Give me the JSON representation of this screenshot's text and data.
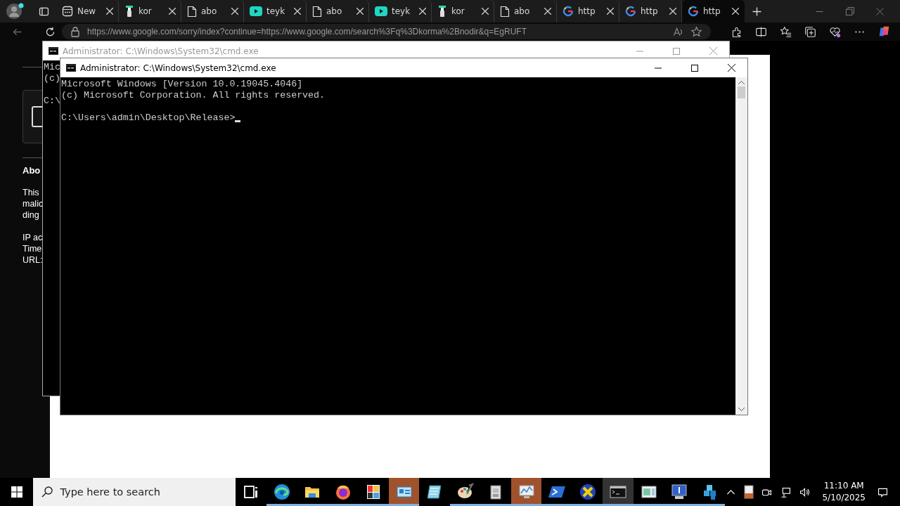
{
  "browser": {
    "tabs": [
      {
        "kind": "news",
        "label": "New",
        "selected": false
      },
      {
        "kind": "figure",
        "label": "kor",
        "selected": false
      },
      {
        "kind": "page",
        "label": "abo",
        "selected": false
      },
      {
        "kind": "play",
        "label": "teyk",
        "selected": false
      },
      {
        "kind": "page",
        "label": "abo",
        "selected": false
      },
      {
        "kind": "play",
        "label": "teyk",
        "selected": false
      },
      {
        "kind": "figure",
        "label": "kor",
        "selected": false
      },
      {
        "kind": "page",
        "label": "abo",
        "selected": false
      },
      {
        "kind": "google",
        "label": "http",
        "selected": false
      },
      {
        "kind": "google",
        "label": "http",
        "selected": false
      },
      {
        "kind": "google",
        "label": "http",
        "selected": true
      }
    ],
    "address": "https://www.google.com/sorry/index?continue=https://www.google.com/search%3Fq%3Dkorma%2Bnodir&q=EgRUFT",
    "page": {
      "heading": "Abo",
      "paragraph": [
        "This",
        "malic",
        "ding"
      ],
      "details": [
        "IP ac",
        "Time",
        "URL:"
      ]
    }
  },
  "windows": [
    {
      "title": "Administrator: C:\\Windows\\System32\\cmd.exe",
      "focused": false,
      "lines": [
        {
          "text": "Mic"
        },
        {
          "text": "(c)"
        },
        {
          "text": "C:\\",
          "gap_before": true
        }
      ]
    },
    {
      "title": "Administrator: C:\\Windows\\System32\\cmd.exe",
      "focused": true,
      "lines": [
        {
          "text": "Microsoft Windows [Version 10.0.19045.4046]"
        },
        {
          "text": "(c) Microsoft Corporation. All rights reserved."
        },
        {
          "text": "C:\\Users\\admin\\Desktop\\Release>",
          "gap_before": true
        }
      ]
    }
  ],
  "taskbar": {
    "search": {
      "placeholder": "Type here to search"
    },
    "apps": [
      {
        "kind": "taskview",
        "running": false,
        "highlighted": false,
        "selected": false
      },
      {
        "kind": "edge",
        "running": true,
        "highlighted": false,
        "selected": false
      },
      {
        "kind": "folder",
        "running": true,
        "highlighted": false,
        "selected": false
      },
      {
        "kind": "firefox",
        "running": true,
        "highlighted": false,
        "selected": false
      },
      {
        "kind": "tiles",
        "running": true,
        "highlighted": false,
        "selected": false
      },
      {
        "kind": "card",
        "running": true,
        "highlighted": true,
        "selected": false
      },
      {
        "kind": "notebook",
        "running": false,
        "highlighted": false,
        "selected": false
      },
      {
        "kind": "palette",
        "running": true,
        "highlighted": false,
        "selected": false
      },
      {
        "kind": "box",
        "running": true,
        "highlighted": false,
        "selected": false
      },
      {
        "kind": "monitorchart",
        "running": true,
        "highlighted": true,
        "selected": false
      },
      {
        "kind": "powershell",
        "running": true,
        "highlighted": false,
        "selected": false
      },
      {
        "kind": "xcircle",
        "running": true,
        "highlighted": false,
        "selected": false
      },
      {
        "kind": "terminal",
        "running": true,
        "highlighted": false,
        "selected": true
      },
      {
        "kind": "form",
        "running": true,
        "highlighted": false,
        "selected": false
      },
      {
        "kind": "monitor",
        "running": true,
        "highlighted": false,
        "selected": false
      },
      {
        "kind": "cubes",
        "running": true,
        "highlighted": false,
        "selected": false
      }
    ],
    "time": "11:10 AM",
    "date": "5/10/2025"
  }
}
